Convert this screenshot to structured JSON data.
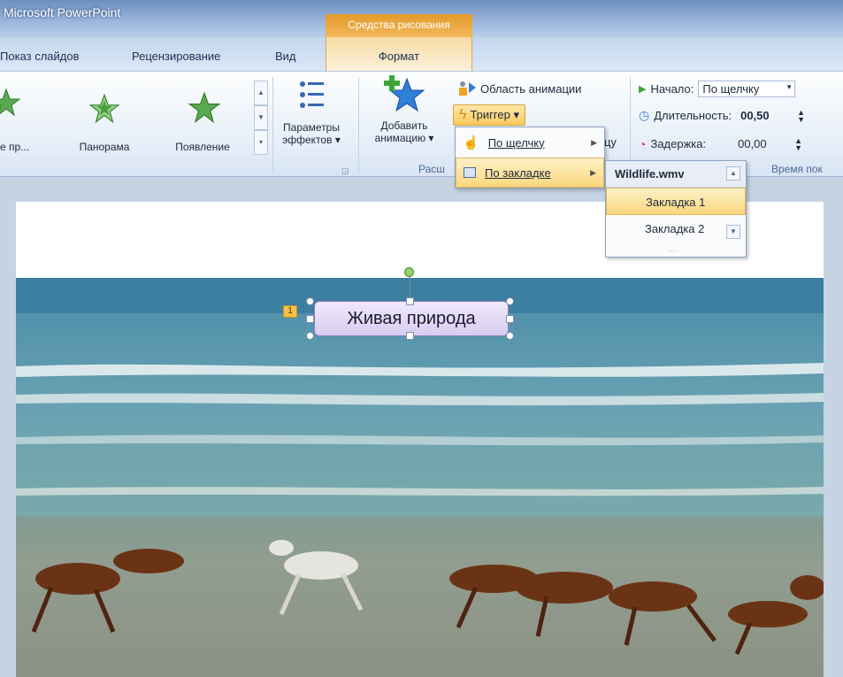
{
  "window": {
    "app_title": "Microsoft PowerPoint",
    "context_title": "Средства рисования"
  },
  "tabs": {
    "slideshow": "Показ слайдов",
    "review": "Рецензирование",
    "view": "Вид",
    "format": "Формат"
  },
  "ribbon": {
    "effects": [
      {
        "label": "е пр...",
        "icon": "star-partial-icon"
      },
      {
        "label": "Панорама",
        "icon": "star-panorama-icon"
      },
      {
        "label": "Появление",
        "icon": "star-appear-icon"
      }
    ],
    "effect_params": {
      "line1": "Параметры",
      "line2": "эффектов ▾"
    },
    "add_animation": {
      "line1": "Добавить",
      "line2": "анимацию ▾"
    },
    "animation_pane": "Область анимации",
    "trigger": "Триггер ▾",
    "group_ext_label": "Расш",
    "timing": {
      "start_label": "Начало:",
      "start_value": "По щелчку",
      "duration_label": "Длительность:",
      "duration_value": "00,50",
      "delay_label": "Задержка:",
      "delay_value": "00,00",
      "group_label": "Время пок"
    },
    "partial_text": "зцу"
  },
  "trigger_menu": {
    "items": [
      {
        "label": "По щелчку",
        "icon": "mouse-click-icon"
      },
      {
        "label": "По закладке",
        "icon": "bookmark-icon"
      }
    ]
  },
  "bookmark_submenu": {
    "header": "Wildlife.wmv",
    "items": [
      "Закладка 1",
      "Закладка 2"
    ]
  },
  "slide": {
    "textbox": "Живая природа",
    "animation_number": "1"
  },
  "colors": {
    "accent_orange": "#f2b85b",
    "menu_highlight": "#fbd77d",
    "ribbon_blue": "#dbe7f6"
  }
}
